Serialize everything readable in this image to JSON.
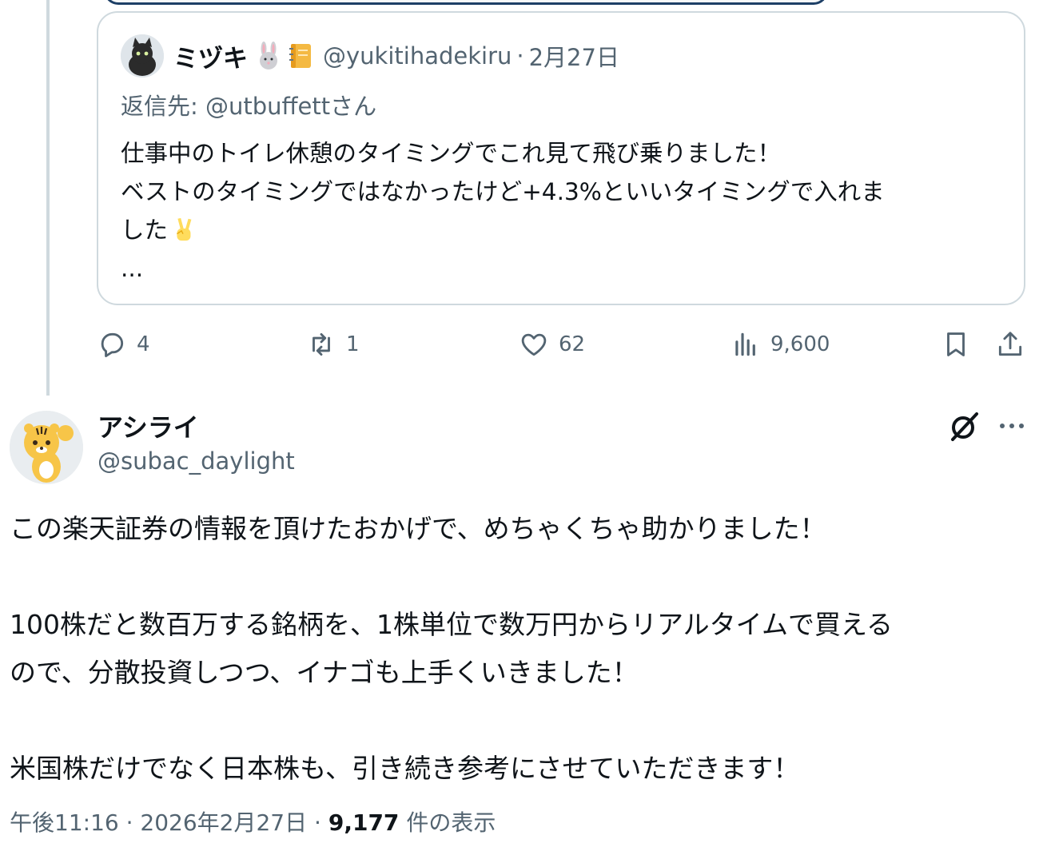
{
  "quoted": {
    "display_name": "ミヅキ",
    "name_emojis": [
      "rabbit-emoji",
      "notebook-emoji"
    ],
    "handle": "@yukitihadekiru",
    "separator": "·",
    "date": "2月27日",
    "reply_to": "返信先: @utbuffettさん",
    "lines": [
      "仕事中のトイレ休憩のタイミングでこれ見て飛び乗りました！",
      "ベストのタイミングではなかったけど+4.3%といいタイミングで入れま",
      "した",
      "..."
    ],
    "line3_emoji": "victory-hand-emoji"
  },
  "actions": {
    "replies": "4",
    "reposts": "1",
    "likes": "62",
    "views": "9,600"
  },
  "post": {
    "display_name": "アシライ",
    "handle": "@subac_daylight",
    "paragraphs": [
      "この楽天証券の情報を頂けたおかげで、めちゃくちゃ助かりました！",
      "",
      "100株だと数百万する銘柄を、1株単位で数万円からリアルタイムで買える",
      "ので、分散投資しつつ、イナゴも上手くいきました！",
      "",
      "米国株だけでなく日本株も、引き続き参考にさせていただきます！"
    ],
    "time": "午後11:16",
    "date": "2026年2月27日",
    "views_count": "9,177",
    "views_label": "件の表示"
  },
  "colors": {
    "secondary": "#536471",
    "border": "#cfd9de",
    "text": "#0f1419"
  }
}
